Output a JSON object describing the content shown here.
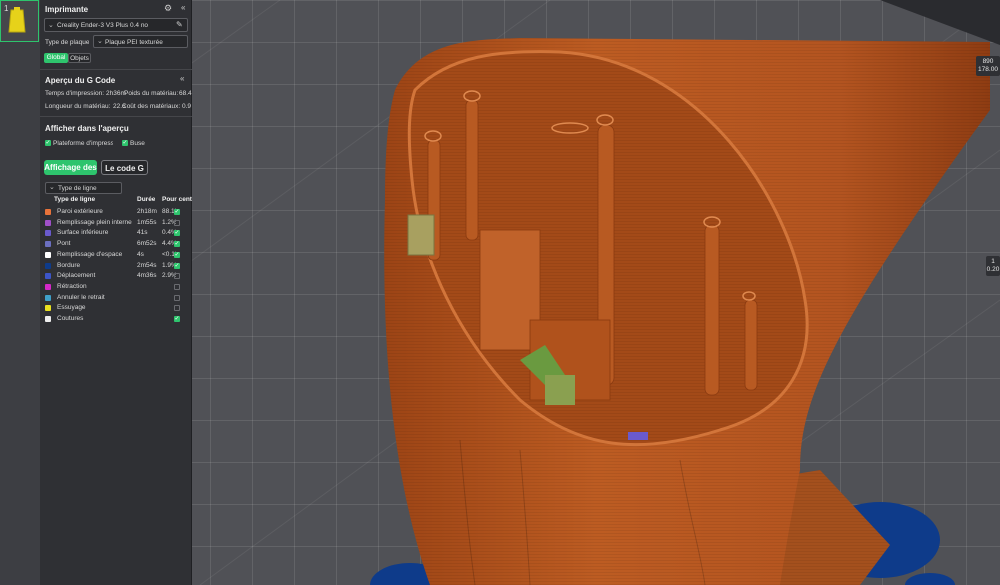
{
  "object_list": {
    "number": "1"
  },
  "printer": {
    "title": "Imprimante",
    "printer_name": "Creality Ender-3 V3 Plus 0.4 no",
    "plate_label": "Type de plaque",
    "plate_value": "Plaque PEI texturée",
    "tabs": [
      {
        "label": "Global"
      },
      {
        "label": "Objets"
      }
    ]
  },
  "gcode": {
    "title": "Aperçu du G Code",
    "collapse_icon": "«",
    "print_time_label": "Temps d'impression:",
    "print_time_value": "2h36m",
    "material_weight_label": "Poids du matériau:",
    "material_weight_value": "68.4",
    "material_length_label": "Longueur du matériau:",
    "material_length_value": "22.6",
    "material_cost_label": "Coût des matériaux:",
    "material_cost_value": "0.9"
  },
  "preview": {
    "title": "Afficher dans l'aperçu",
    "checkbox_plate": "Plateforme d'impression",
    "checkbox_nozzle": "Buse",
    "button_display": "Affichage des",
    "button_gcode": "Le code G",
    "line_type_dropdown": "Type de ligne",
    "col_type": "Type de ligne",
    "col_duration": "Durée",
    "col_percent": "Pour cent",
    "rows": [
      {
        "label": "Paroi extérieure",
        "duration": "2h18m",
        "percent": "88.1%",
        "color": "#e8733a",
        "checked": true
      },
      {
        "label": "Remplissage plein interne",
        "duration": "1m55s",
        "percent": "1.2%",
        "color": "#a050c8",
        "checked": false
      },
      {
        "label": "Surface inférieure",
        "duration": "41s",
        "percent": "0.4%",
        "color": "#6a5acd",
        "checked": true
      },
      {
        "label": "Pont",
        "duration": "6m52s",
        "percent": "4.4%",
        "color": "#6b6fc0",
        "checked": true
      },
      {
        "label": "Remplissage d'espace",
        "duration": "4s",
        "percent": "<0.1%",
        "color": "#ffffff",
        "checked": true
      },
      {
        "label": "Bordure",
        "duration": "2m54s",
        "percent": "1.9%",
        "color": "#0e3b8a",
        "checked": true
      },
      {
        "label": "Déplacement",
        "duration": "4m36s",
        "percent": "2.9%",
        "color": "#3c55c8",
        "checked": false
      },
      {
        "label": "Rétraction",
        "duration": "",
        "percent": "",
        "color": "#d428c8",
        "checked": false
      },
      {
        "label": "Annuler le retrait",
        "duration": "",
        "percent": "",
        "color": "#3fa0c8",
        "checked": false
      },
      {
        "label": "Essuyage",
        "duration": "",
        "percent": "",
        "color": "#e8e020",
        "checked": false
      },
      {
        "label": "Coutures",
        "duration": "",
        "percent": "",
        "color": "#eeeeee",
        "checked": true
      }
    ]
  },
  "readouts": {
    "top_value": "890",
    "top_height": "178.00",
    "side_value": "1",
    "side_height": "0.20"
  },
  "colors": {
    "accent": "#2ec46d",
    "model_orange": "#b4551e",
    "brim_blue": "#0e3b8a"
  }
}
